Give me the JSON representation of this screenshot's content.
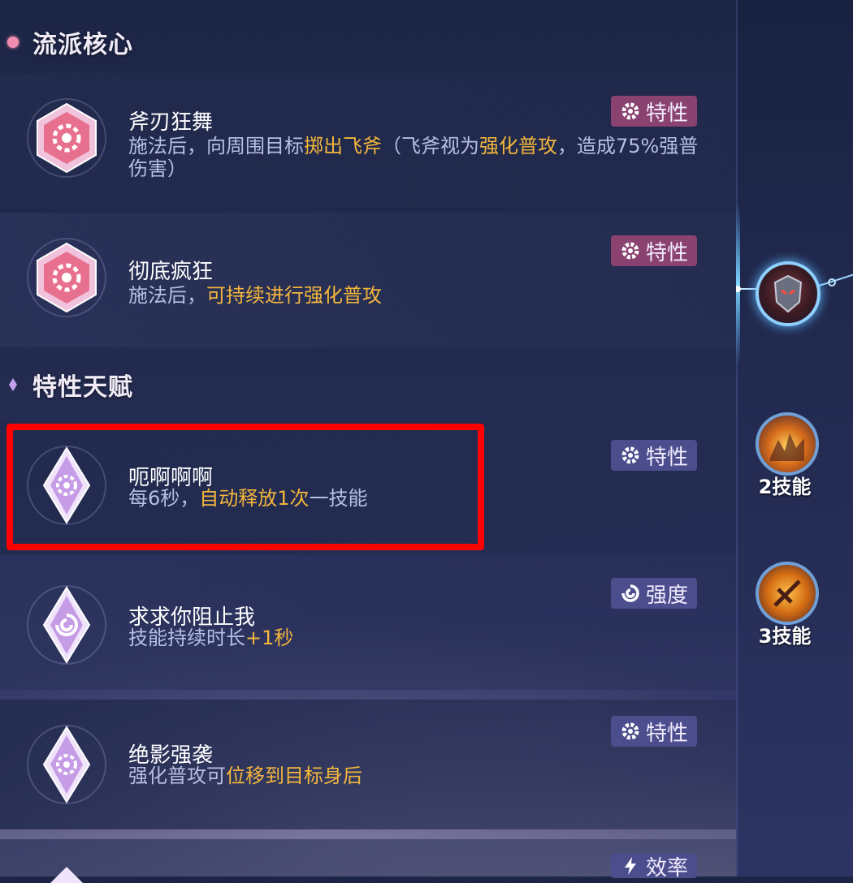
{
  "sections": {
    "core": {
      "title": "流派核心"
    },
    "talent": {
      "title": "特性天赋"
    }
  },
  "cards": [
    {
      "name": "斧刃狂舞",
      "tag": "特性",
      "tag_icon": "gear-icon",
      "tag_color": "#8a4270",
      "desc_parts": [
        "施法后，向周围目标",
        "掷出飞斧",
        "（飞斧视为",
        "强化普攻",
        "，造成75%强普伤害）"
      ]
    },
    {
      "name": "彻底疯狂",
      "tag": "特性",
      "tag_icon": "gear-icon",
      "tag_color": "#8a4270",
      "desc_parts": [
        "施法后，",
        "可持续进行强化普攻"
      ]
    },
    {
      "name": "呃啊啊啊",
      "tag": "特性",
      "tag_icon": "gear-icon",
      "tag_color": "#4b4d8c",
      "desc_parts": [
        "每6秒，",
        "自动释放1次",
        "一技能"
      ]
    },
    {
      "name": "求求你阻止我",
      "tag": "强度",
      "tag_icon": "swirl-icon",
      "tag_color": "#4b4d8c",
      "desc_parts": [
        "技能持续时长",
        "+1秒"
      ]
    },
    {
      "name": "绝影强袭",
      "tag": "特性",
      "tag_icon": "gear-icon",
      "tag_color": "#4b4d8c",
      "desc_parts": [
        "强化普攻可",
        "位移到目标身后"
      ]
    },
    {
      "tag": "效率",
      "tag_icon": "lightning-icon",
      "tag_color": "#4b4d8c"
    }
  ],
  "skills": [
    {
      "label": ""
    },
    {
      "label": "2技能"
    },
    {
      "label": "3技能"
    }
  ],
  "colors": {
    "highlight": "#f4b63c",
    "selection_box": "#ff0000"
  }
}
